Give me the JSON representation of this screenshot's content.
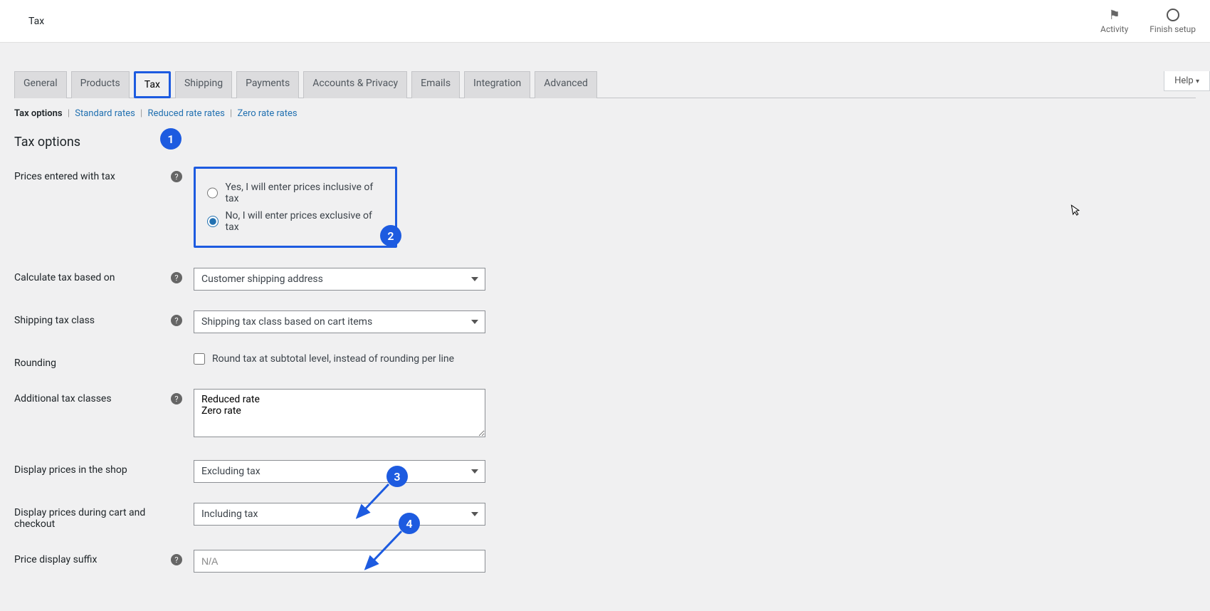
{
  "topbar": {
    "title": "Tax",
    "activity": "Activity",
    "finish_setup": "Finish setup"
  },
  "help_button": "Help",
  "tabs": {
    "general": "General",
    "products": "Products",
    "tax": "Tax",
    "shipping": "Shipping",
    "payments": "Payments",
    "accounts_privacy": "Accounts & Privacy",
    "emails": "Emails",
    "integration": "Integration",
    "advanced": "Advanced"
  },
  "subnav": {
    "tax_options": "Tax options",
    "standard_rates": "Standard rates",
    "reduced_rate_rates": "Reduced rate rates",
    "zero_rate_rates": "Zero rate rates"
  },
  "section_title": "Tax options",
  "labels": {
    "prices_entered": "Prices entered with tax",
    "calculate_tax": "Calculate tax based on",
    "shipping_tax_class": "Shipping tax class",
    "rounding": "Rounding",
    "additional_tax_classes": "Additional tax classes",
    "display_prices_shop": "Display prices in the shop",
    "display_prices_cart": "Display prices during cart and checkout",
    "price_display_suffix": "Price display suffix"
  },
  "radio": {
    "inclusive": "Yes, I will enter prices inclusive of tax",
    "exclusive": "No, I will enter prices exclusive of tax"
  },
  "selects": {
    "calculate_tax": "Customer shipping address",
    "shipping_tax_class": "Shipping tax class based on cart items",
    "display_shop": "Excluding tax",
    "display_cart": "Including tax"
  },
  "checkbox": {
    "rounding": "Round tax at subtotal level, instead of rounding per line"
  },
  "textarea": {
    "additional_tax_classes": "Reduced rate\nZero rate"
  },
  "placeholders": {
    "price_suffix": "N/A"
  },
  "callouts": {
    "b1": "1",
    "b2": "2",
    "b3": "3",
    "b4": "4"
  }
}
